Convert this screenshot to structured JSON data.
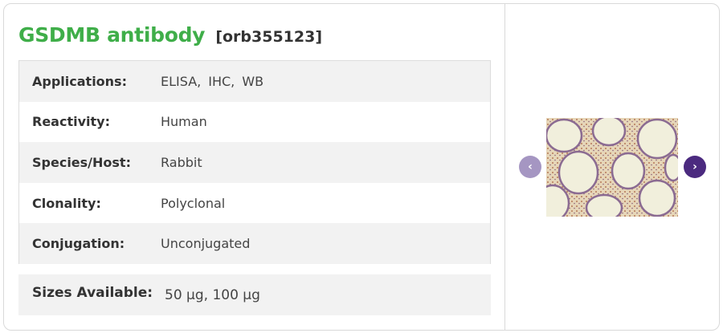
{
  "product": {
    "name": "GSDMB antibody",
    "catalog": "[orb355123]"
  },
  "specs": [
    {
      "label": "Applications:",
      "values": [
        "ELISA,",
        "IHC,",
        "WB"
      ]
    },
    {
      "label": "Reactivity:",
      "value": "Human"
    },
    {
      "label": "Species/Host:",
      "value": "Rabbit"
    },
    {
      "label": "Clonality:",
      "value": "Polyclonal"
    },
    {
      "label": "Conjugation:",
      "value": "Unconjugated"
    }
  ],
  "sizes": {
    "label": "Sizes Available:",
    "value": "50 μg, 100 μg"
  },
  "gallery": {
    "prev_icon": "chevron-left-icon",
    "next_icon": "chevron-right-icon",
    "prev_glyph": "‹",
    "next_glyph": "›",
    "colors": {
      "prev": "#a596c2",
      "next": "#4b2a7f",
      "title": "#3fae49"
    }
  }
}
